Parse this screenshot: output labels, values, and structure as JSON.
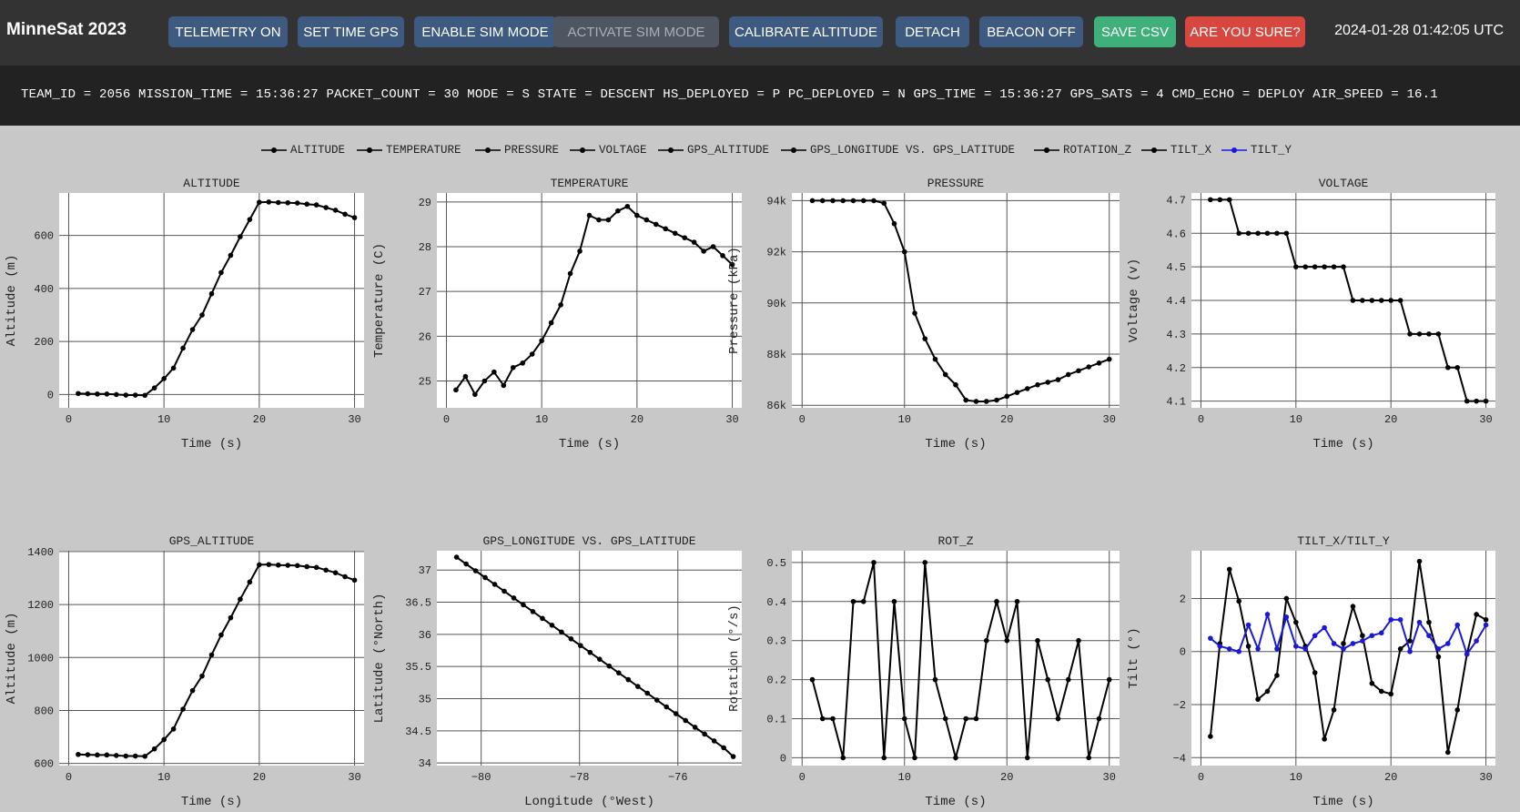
{
  "header": {
    "title": "MinneSat 2023",
    "datetime": "2024-01-28 01:42:05 UTC",
    "buttons": [
      {
        "label": "TELEMETRY ON",
        "style": "blue"
      },
      {
        "label": "SET TIME GPS",
        "style": "blue"
      },
      {
        "label": "ENABLE SIM MODE",
        "style": "blue"
      },
      {
        "label": "ACTIVATE SIM MODE",
        "style": "disabled"
      },
      {
        "label": "CALIBRATE ALTITUDE",
        "style": "blue"
      },
      {
        "label": "DETACH",
        "style": "blue"
      },
      {
        "label": "BEACON OFF",
        "style": "blue"
      },
      {
        "label": "SAVE CSV",
        "style": "green"
      },
      {
        "label": "ARE YOU SURE?",
        "style": "red"
      }
    ]
  },
  "colors": {
    "header_bg": "#333333",
    "telemetry_bg": "#222222",
    "page_bg": "#c8c8c8",
    "button_blue": "#3e5a80",
    "button_green": "#3fb07a",
    "button_red": "#d7473f",
    "series_black": "#000000",
    "series_blue": "#1a1ad6"
  },
  "telemetry_line": "TEAM_ID = 2056 MISSION_TIME = 15:36:27 PACKET_COUNT = 30 MODE = S STATE = DESCENT HS_DEPLOYED = P PC_DEPLOYED = N GPS_TIME = 15:36:27 GPS_SATS = 4 CMD_ECHO = DEPLOY AIR_SPEED = 16.1",
  "legend": [
    {
      "label": "ALTITUDE",
      "color": "#000000"
    },
    {
      "label": "TEMPERATURE",
      "color": "#000000"
    },
    {
      "label": "PRESSURE",
      "color": "#000000"
    },
    {
      "label": "VOLTAGE",
      "color": "#000000"
    },
    {
      "label": "GPS_ALTITUDE",
      "color": "#000000"
    },
    {
      "label": "GPS_LONGITUDE VS. GPS_LATITUDE",
      "color": "#000000"
    },
    {
      "label": "ROTATION_Z",
      "color": "#000000"
    },
    {
      "label": "TILT_X",
      "color": "#000000"
    },
    {
      "label": "TILT_Y",
      "color": "#1a1ad6"
    }
  ],
  "chart_data": [
    {
      "type": "line",
      "title": "ALTITUDE",
      "xlabel": "Time (s)",
      "ylabel": "Altitude (m)",
      "xlim": [
        -1,
        31
      ],
      "ylim": [
        -50,
        760
      ],
      "xticks": [
        {
          "v": 0,
          "label": "0"
        },
        {
          "v": 10,
          "label": "10"
        },
        {
          "v": 20,
          "label": "20"
        },
        {
          "v": 30,
          "label": "30"
        }
      ],
      "yticks": [
        {
          "v": 0,
          "label": "0"
        },
        {
          "v": 200,
          "label": "200"
        },
        {
          "v": 400,
          "label": "400"
        },
        {
          "v": 600,
          "label": "600"
        }
      ],
      "series": [
        {
          "color": "#000000",
          "x": [
            1,
            2,
            3,
            4,
            5,
            6,
            7,
            8,
            9,
            10,
            11,
            12,
            13,
            14,
            15,
            16,
            17,
            18,
            19,
            20,
            21,
            22,
            23,
            24,
            25,
            26,
            27,
            28,
            29,
            30
          ],
          "y": [
            4,
            3,
            2,
            2,
            0,
            -2,
            -2,
            -3,
            25,
            60,
            100,
            175,
            245,
            300,
            380,
            460,
            525,
            595,
            660,
            725,
            726,
            724,
            723,
            722,
            718,
            715,
            705,
            695,
            680,
            667
          ]
        }
      ]
    },
    {
      "type": "line",
      "title": "TEMPERATURE",
      "xlabel": "Time (s)",
      "ylabel": "Temperature (C)",
      "xlim": [
        -1,
        31
      ],
      "ylim": [
        24.4,
        29.2
      ],
      "xticks": [
        {
          "v": 0,
          "label": "0"
        },
        {
          "v": 10,
          "label": "10"
        },
        {
          "v": 20,
          "label": "20"
        },
        {
          "v": 30,
          "label": "30"
        }
      ],
      "yticks": [
        {
          "v": 25,
          "label": "25"
        },
        {
          "v": 26,
          "label": "26"
        },
        {
          "v": 27,
          "label": "27"
        },
        {
          "v": 28,
          "label": "28"
        },
        {
          "v": 29,
          "label": "29"
        }
      ],
      "series": [
        {
          "color": "#000000",
          "x": [
            1,
            2,
            3,
            4,
            5,
            6,
            7,
            8,
            9,
            10,
            11,
            12,
            13,
            14,
            15,
            16,
            17,
            18,
            19,
            20,
            21,
            22,
            23,
            24,
            25,
            26,
            27,
            28,
            29,
            30
          ],
          "y": [
            24.8,
            25.1,
            24.7,
            25.0,
            25.2,
            24.9,
            25.3,
            25.4,
            25.6,
            25.9,
            26.3,
            26.7,
            27.4,
            27.9,
            28.7,
            28.6,
            28.6,
            28.8,
            28.9,
            28.7,
            28.6,
            28.5,
            28.4,
            28.3,
            28.2,
            28.1,
            27.9,
            28.0,
            27.8,
            27.6
          ]
        }
      ]
    },
    {
      "type": "line",
      "title": "PRESSURE",
      "xlabel": "Time (s)",
      "ylabel": "Pressure (kPa)",
      "xlim": [
        -1,
        31
      ],
      "ylim": [
        85900,
        94300
      ],
      "xticks": [
        {
          "v": 0,
          "label": "0"
        },
        {
          "v": 10,
          "label": "10"
        },
        {
          "v": 20,
          "label": "20"
        },
        {
          "v": 30,
          "label": "30"
        }
      ],
      "yticks": [
        {
          "v": 86000,
          "label": "86k"
        },
        {
          "v": 88000,
          "label": "88k"
        },
        {
          "v": 90000,
          "label": "90k"
        },
        {
          "v": 92000,
          "label": "92k"
        },
        {
          "v": 94000,
          "label": "94k"
        }
      ],
      "series": [
        {
          "color": "#000000",
          "x": [
            1,
            2,
            3,
            4,
            5,
            6,
            7,
            8,
            9,
            10,
            11,
            12,
            13,
            14,
            15,
            16,
            17,
            18,
            19,
            20,
            21,
            22,
            23,
            24,
            25,
            26,
            27,
            28,
            29,
            30
          ],
          "y": [
            94000,
            94000,
            94000,
            94000,
            94000,
            94000,
            94000,
            93900,
            93100,
            92000,
            89600,
            88600,
            87800,
            87200,
            86800,
            86200,
            86150,
            86150,
            86200,
            86350,
            86500,
            86650,
            86800,
            86900,
            87000,
            87200,
            87350,
            87500,
            87650,
            87800
          ]
        }
      ]
    },
    {
      "type": "line",
      "title": "VOLTAGE",
      "xlabel": "Time (s)",
      "ylabel": "Voltage (v)",
      "xlim": [
        -1,
        31
      ],
      "ylim": [
        4.08,
        4.72
      ],
      "xticks": [
        {
          "v": 0,
          "label": "0"
        },
        {
          "v": 10,
          "label": "10"
        },
        {
          "v": 20,
          "label": "20"
        },
        {
          "v": 30,
          "label": "30"
        }
      ],
      "yticks": [
        {
          "v": 4.1,
          "label": "4.1"
        },
        {
          "v": 4.2,
          "label": "4.2"
        },
        {
          "v": 4.3,
          "label": "4.3"
        },
        {
          "v": 4.4,
          "label": "4.4"
        },
        {
          "v": 4.5,
          "label": "4.5"
        },
        {
          "v": 4.6,
          "label": "4.6"
        },
        {
          "v": 4.7,
          "label": "4.7"
        }
      ],
      "series": [
        {
          "color": "#000000",
          "x": [
            1,
            2,
            3,
            4,
            5,
            6,
            7,
            8,
            9,
            10,
            11,
            12,
            13,
            14,
            15,
            16,
            17,
            18,
            19,
            20,
            21,
            22,
            23,
            24,
            25,
            26,
            27,
            28,
            29,
            30
          ],
          "y": [
            4.7,
            4.7,
            4.7,
            4.6,
            4.6,
            4.6,
            4.6,
            4.6,
            4.6,
            4.5,
            4.5,
            4.5,
            4.5,
            4.5,
            4.5,
            4.4,
            4.4,
            4.4,
            4.4,
            4.4,
            4.4,
            4.3,
            4.3,
            4.3,
            4.3,
            4.2,
            4.2,
            4.1,
            4.1,
            4.1
          ]
        }
      ]
    },
    {
      "type": "line",
      "title": "GPS_ALTITUDE",
      "xlabel": "Time (s)",
      "ylabel": "Altitude (m)",
      "xlim": [
        -1,
        31
      ],
      "ylim": [
        592,
        1403
      ],
      "xticks": [
        {
          "v": 0,
          "label": "0"
        },
        {
          "v": 10,
          "label": "10"
        },
        {
          "v": 20,
          "label": "20"
        },
        {
          "v": 30,
          "label": "30"
        }
      ],
      "yticks": [
        {
          "v": 600,
          "label": "600"
        },
        {
          "v": 800,
          "label": "800"
        },
        {
          "v": 1000,
          "label": "1000"
        },
        {
          "v": 1200,
          "label": "1200"
        },
        {
          "v": 1400,
          "label": "1400"
        }
      ],
      "series": [
        {
          "color": "#000000",
          "x": [
            1,
            2,
            3,
            4,
            5,
            6,
            7,
            8,
            9,
            10,
            11,
            12,
            13,
            14,
            15,
            16,
            17,
            18,
            19,
            20,
            21,
            22,
            23,
            24,
            25,
            26,
            27,
            28,
            29,
            30
          ],
          "y": [
            634,
            633,
            632,
            632,
            630,
            628,
            628,
            627,
            655,
            690,
            730,
            805,
            875,
            930,
            1010,
            1085,
            1150,
            1220,
            1285,
            1350,
            1351,
            1349,
            1348,
            1347,
            1343,
            1340,
            1330,
            1320,
            1305,
            1292
          ]
        }
      ]
    },
    {
      "type": "line",
      "title": "GPS_LONGITUDE VS. GPS_LATITUDE",
      "xlabel": "Longitude (°West)",
      "ylabel": "Latitude (°North)",
      "xlim": [
        -80.9,
        -74.7
      ],
      "ylim": [
        33.96,
        37.3
      ],
      "xticks": [
        {
          "v": -80,
          "label": "−80"
        },
        {
          "v": -78,
          "label": "−78"
        },
        {
          "v": -76,
          "label": "−76"
        }
      ],
      "yticks": [
        {
          "v": 34,
          "label": "34"
        },
        {
          "v": 34.5,
          "label": "34.5"
        },
        {
          "v": 35,
          "label": "35"
        },
        {
          "v": 35.5,
          "label": "35.5"
        },
        {
          "v": 36,
          "label": "36"
        },
        {
          "v": 36.5,
          "label": "36.5"
        },
        {
          "v": 37,
          "label": "37"
        }
      ],
      "series": [
        {
          "color": "#000000",
          "x": [
            -80.5,
            -80.306,
            -80.112,
            -79.918,
            -79.724,
            -79.53,
            -79.336,
            -79.142,
            -78.948,
            -78.754,
            -78.56,
            -78.366,
            -78.172,
            -77.978,
            -77.784,
            -77.59,
            -77.396,
            -77.202,
            -77.008,
            -76.814,
            -76.62,
            -76.426,
            -76.232,
            -76.038,
            -75.844,
            -75.65,
            -75.456,
            -75.262,
            -75.068,
            -74.874
          ],
          "y": [
            37.2,
            37.094,
            36.988,
            36.883,
            36.777,
            36.671,
            36.565,
            36.459,
            36.354,
            36.248,
            36.142,
            36.036,
            35.93,
            35.825,
            35.719,
            35.613,
            35.507,
            35.401,
            35.296,
            35.19,
            35.084,
            34.978,
            34.872,
            34.766,
            34.661,
            34.555,
            34.449,
            34.343,
            34.237,
            34.1
          ]
        }
      ]
    },
    {
      "type": "line",
      "title": "ROT_Z",
      "xlabel": "Time (s)",
      "ylabel": "Rotation (°/s)",
      "xlim": [
        -1,
        31
      ],
      "ylim": [
        -0.02,
        0.53
      ],
      "xticks": [
        {
          "v": 0,
          "label": "0"
        },
        {
          "v": 10,
          "label": "10"
        },
        {
          "v": 20,
          "label": "20"
        },
        {
          "v": 30,
          "label": "30"
        }
      ],
      "yticks": [
        {
          "v": 0,
          "label": "0"
        },
        {
          "v": 0.1,
          "label": "0.1"
        },
        {
          "v": 0.2,
          "label": "0.2"
        },
        {
          "v": 0.3,
          "label": "0.3"
        },
        {
          "v": 0.4,
          "label": "0.4"
        },
        {
          "v": 0.5,
          "label": "0.5"
        }
      ],
      "series": [
        {
          "color": "#000000",
          "x": [
            1,
            2,
            3,
            4,
            5,
            6,
            7,
            8,
            9,
            10,
            11,
            12,
            13,
            14,
            15,
            16,
            17,
            18,
            19,
            20,
            21,
            22,
            23,
            24,
            25,
            26,
            27,
            28,
            29,
            30
          ],
          "y": [
            0.2,
            0.1,
            0.1,
            0,
            0.4,
            0.4,
            0.5,
            0,
            0.4,
            0.1,
            0,
            0.5,
            0.2,
            0.1,
            0,
            0.1,
            0.1,
            0.3,
            0.4,
            0.3,
            0.4,
            0,
            0.3,
            0.2,
            0.1,
            0.2,
            0.3,
            0,
            0.1,
            0.2
          ]
        }
      ]
    },
    {
      "type": "line",
      "title": "TILT_X/TILT_Y",
      "xlabel": "Time (s)",
      "ylabel": "Tilt (°)",
      "xlim": [
        -1,
        31
      ],
      "ylim": [
        -4.3,
        3.8
      ],
      "xticks": [
        {
          "v": 0,
          "label": "0"
        },
        {
          "v": 10,
          "label": "10"
        },
        {
          "v": 20,
          "label": "20"
        },
        {
          "v": 30,
          "label": "30"
        }
      ],
      "yticks": [
        {
          "v": -4,
          "label": "−4"
        },
        {
          "v": -2,
          "label": "−2"
        },
        {
          "v": 0,
          "label": "0"
        },
        {
          "v": 2,
          "label": "2"
        }
      ],
      "series": [
        {
          "name": "TILT_X",
          "color": "#000000",
          "x": [
            1,
            2,
            3,
            4,
            5,
            6,
            7,
            8,
            9,
            10,
            11,
            12,
            13,
            14,
            15,
            16,
            17,
            18,
            19,
            20,
            21,
            22,
            23,
            24,
            25,
            26,
            27,
            28,
            29,
            30
          ],
          "y": [
            -3.2,
            0.3,
            3.1,
            1.9,
            0.2,
            -1.8,
            -1.5,
            -0.9,
            2.0,
            1.1,
            0.2,
            -0.8,
            -3.3,
            -2.2,
            0.3,
            1.7,
            0.6,
            -1.2,
            -1.5,
            -1.6,
            0.1,
            0.4,
            3.4,
            1.1,
            -0.2,
            -3.8,
            -2.2,
            -0.1,
            1.4,
            1.2
          ]
        },
        {
          "name": "TILT_Y",
          "color": "#1a1ad6",
          "x": [
            1,
            2,
            3,
            4,
            5,
            6,
            7,
            8,
            9,
            10,
            11,
            12,
            13,
            14,
            15,
            16,
            17,
            18,
            19,
            20,
            21,
            22,
            23,
            24,
            25,
            26,
            27,
            28,
            29,
            30
          ],
          "y": [
            0.5,
            0.2,
            0.1,
            0,
            1.0,
            0.1,
            1.4,
            0.1,
            1.3,
            0.2,
            0.1,
            0.6,
            0.9,
            0.3,
            0.1,
            0.3,
            0.4,
            0.6,
            0.7,
            1.2,
            1.2,
            0,
            1.1,
            0.6,
            0.1,
            0.3,
            1.0,
            -0.1,
            0.4,
            1.0
          ]
        }
      ]
    }
  ]
}
